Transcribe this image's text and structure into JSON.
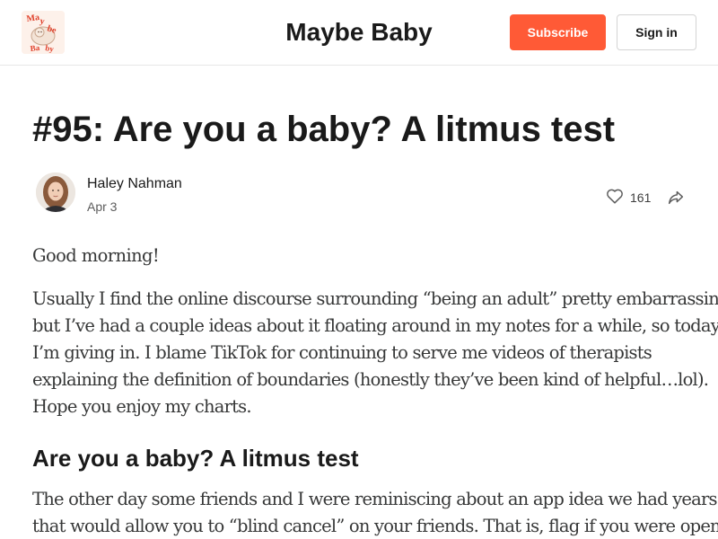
{
  "header": {
    "logo_text": "Maybe Baby",
    "publication_title": "Maybe Baby",
    "subscribe_label": "Subscribe",
    "signin_label": "Sign in",
    "accent_color": "#ff5a36"
  },
  "post": {
    "title": "#95: Are you a baby? A litmus test",
    "author": "Haley Nahman",
    "date": "Apr 3",
    "like_count": "161",
    "icons": {
      "like": "heart-icon",
      "share": "share-icon"
    }
  },
  "body": {
    "greeting": "Good morning!",
    "intro_lines": [
      "Usually I find the online discourse surrounding “being an adult” pretty embarrassing,",
      "but I’ve had a couple ideas about it floating around in my notes for a while, so today",
      "I’m giving in. I blame TikTok for continuing to serve me videos of therapists",
      "explaining the definition of boundaries (honestly they’ve been kind of helpful…lol).",
      "Hope you enjoy my charts."
    ],
    "section_heading": "Are you a baby? A litmus test",
    "story_lines": [
      "The other day some friends and I were reminiscing about an app idea we had years ago",
      "that would allow you to “blind cancel” on your friends. That is, flag if you were open"
    ]
  }
}
